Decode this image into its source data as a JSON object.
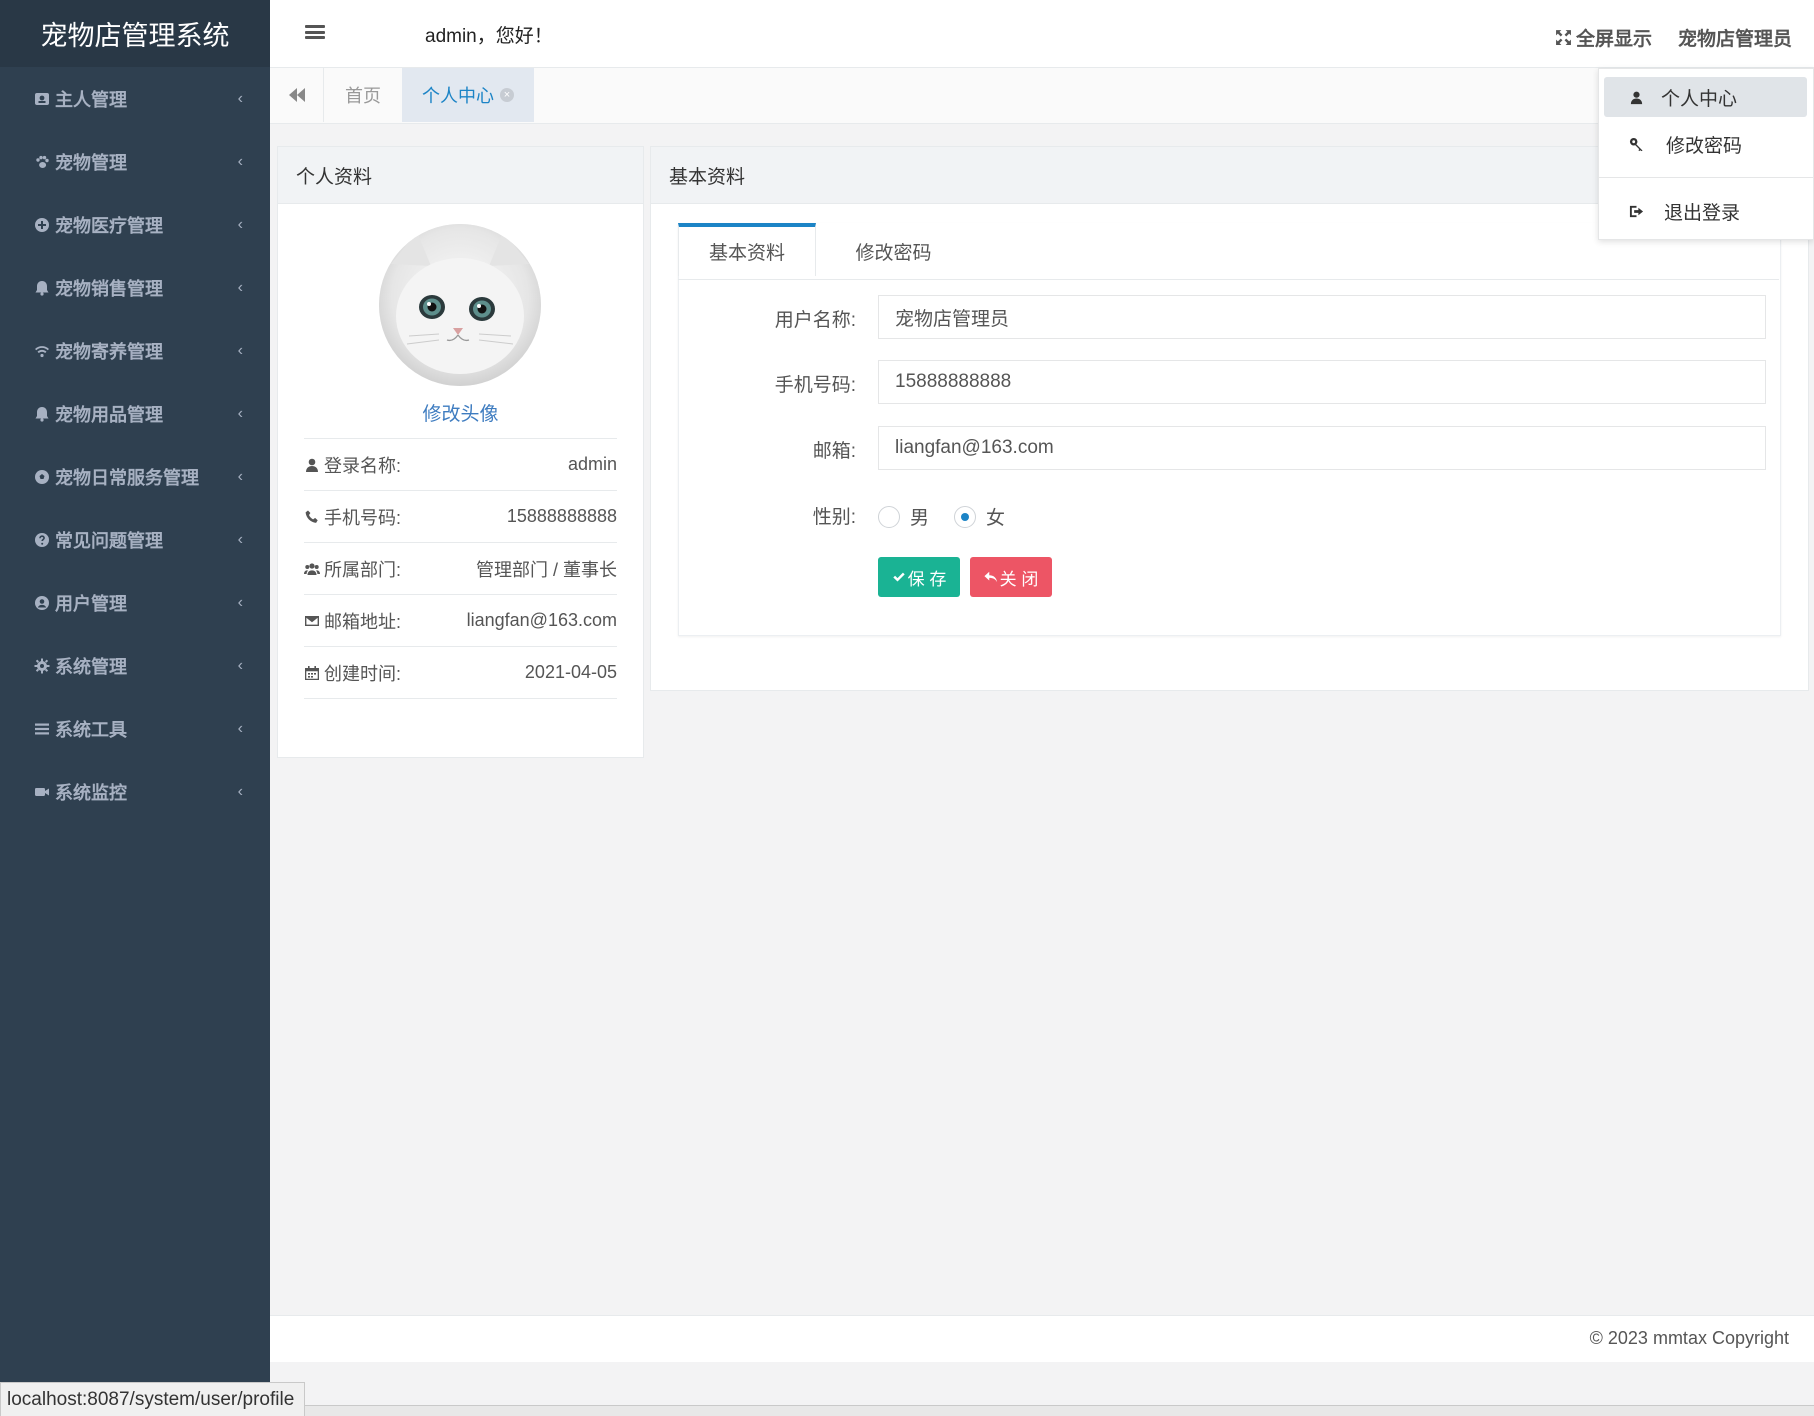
{
  "app": {
    "title": "宠物店管理系统"
  },
  "colors": {
    "sidebar_bg": "#2f4050",
    "accent": "#1c84c6",
    "save": "#1ab394",
    "close": "#ed5565"
  },
  "sidebar": {
    "items": [
      {
        "label": "主人管理",
        "icon": "id-card-icon"
      },
      {
        "label": "宠物管理",
        "icon": "paw-icon"
      },
      {
        "label": "宠物医疗管理",
        "icon": "plus-circle-icon"
      },
      {
        "label": "宠物销售管理",
        "icon": "bell-icon"
      },
      {
        "label": "宠物寄养管理",
        "icon": "wifi-icon"
      },
      {
        "label": "宠物用品管理",
        "icon": "bell-icon"
      },
      {
        "label": "宠物日常服务管理",
        "icon": "soccer-ball-icon"
      },
      {
        "label": "常见问题管理",
        "icon": "question-circle-icon"
      },
      {
        "label": "用户管理",
        "icon": "user-circle-icon"
      },
      {
        "label": "系统管理",
        "icon": "gear-icon"
      },
      {
        "label": "系统工具",
        "icon": "bars-icon"
      },
      {
        "label": "系统监控",
        "icon": "video-camera-icon"
      }
    ],
    "chevron": "‹"
  },
  "header": {
    "greeting": "admin，您好！",
    "fullscreen_label": "全屏显示",
    "user_label": "宠物店管理员"
  },
  "tabs": {
    "home": "首页",
    "active": "个人中心"
  },
  "profile_card": {
    "title": "个人资料",
    "change_avatar": "修改头像",
    "rows": [
      {
        "label": "登录名称:",
        "value": "admin",
        "icon": "user-icon"
      },
      {
        "label": "手机号码:",
        "value": "15888888888",
        "icon": "phone-icon"
      },
      {
        "label": "所属部门:",
        "value": "管理部门 / 董事长",
        "icon": "users-icon"
      },
      {
        "label": "邮箱地址:",
        "value": "liangfan@163.com",
        "icon": "envelope-icon"
      },
      {
        "label": "创建时间:",
        "value": "2021-04-05",
        "icon": "calendar-icon"
      }
    ]
  },
  "basic_card": {
    "title": "基本资料",
    "tab_basic": "基本资料",
    "tab_password": "修改密码",
    "fields": {
      "username_label": "用户名称:",
      "username_value": "宠物店管理员",
      "phone_label": "手机号码:",
      "phone_value": "15888888888",
      "email_label": "邮箱:",
      "email_value": "liangfan@163.com",
      "gender_label": "性别:",
      "male": "男",
      "female": "女",
      "gender_selected": "女"
    },
    "save_label": "保 存",
    "close_label": "关 闭"
  },
  "dropdown": {
    "items": [
      {
        "label": "个人中心",
        "icon": "user-icon"
      },
      {
        "label": "修改密码",
        "icon": "key-icon"
      },
      {
        "label": "退出登录",
        "icon": "sign-out-icon"
      }
    ]
  },
  "footer": {
    "copyright": "© 2023 mmtax Copyright"
  },
  "statusbar": {
    "url": "localhost:8087/system/user/profile"
  }
}
